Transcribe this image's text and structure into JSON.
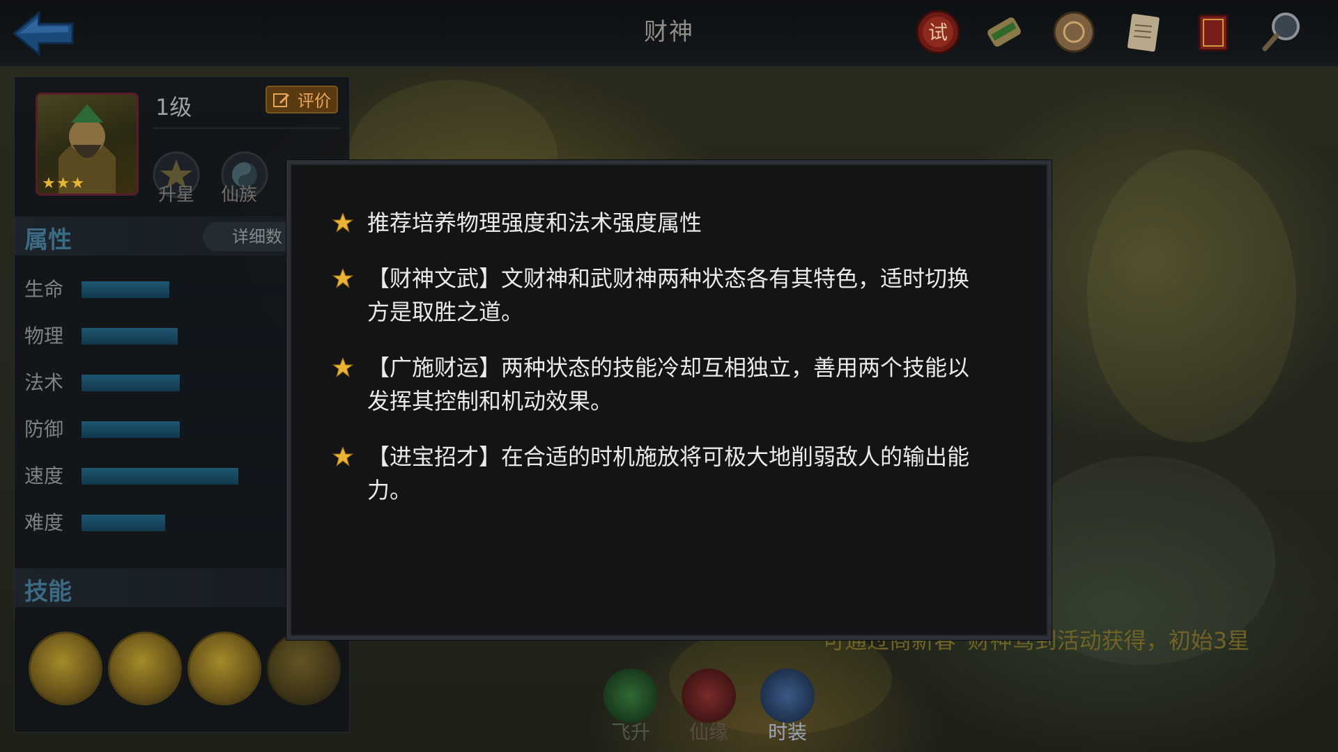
{
  "header": {
    "title": "财神"
  },
  "hero": {
    "level": "1级",
    "rate_label": "评价",
    "stars": "★★★",
    "buttons": [
      {
        "label": "升星"
      },
      {
        "label": "仙族"
      }
    ]
  },
  "attributes": {
    "title": "属性",
    "detail_label": "详细数",
    "stats": [
      {
        "label": "生命",
        "value": 0.42
      },
      {
        "label": "物理",
        "value": 0.46
      },
      {
        "label": "法术",
        "value": 0.47
      },
      {
        "label": "防御",
        "value": 0.47
      },
      {
        "label": "速度",
        "value": 0.75
      },
      {
        "label": "难度",
        "value": 0.4
      }
    ]
  },
  "skills": {
    "title": "技能"
  },
  "source_text": "可通过商新春“财神驾到活动获得，初始3星",
  "bottom_nav": [
    {
      "label": "飞升"
    },
    {
      "label": "仙缘"
    },
    {
      "label": "时装"
    }
  ],
  "dialog": {
    "tips": [
      "推荐培养物理强度和法术强度属性",
      "【财神文武】文财神和武财神两种状态各有其特色，适时切换方是取胜之道。",
      "【广施财运】两种状态的技能冷却互相独立，善用两个技能以发挥其控制和机动效果。",
      "【进宝招才】在合适的时机施放将可极大地削弱敌人的输出能力。"
    ]
  },
  "colors": {
    "accent_blue": "#1d5671",
    "star_gold": "#e7b533",
    "dialog_bg": "#121416"
  }
}
